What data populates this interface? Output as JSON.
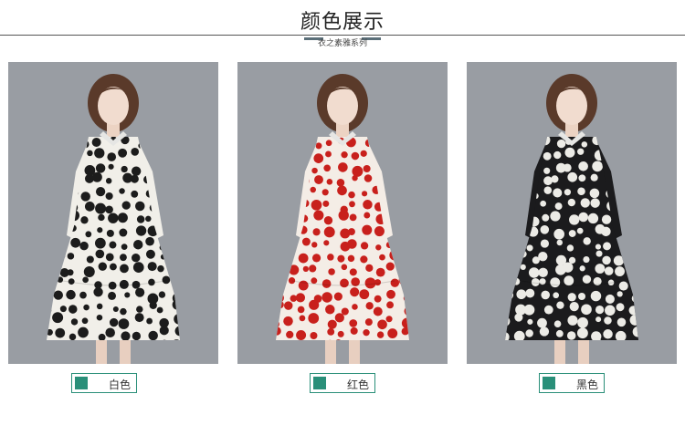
{
  "section": {
    "title": "颜色展示",
    "subtitle": "衣之素雅系列"
  },
  "products": [
    {
      "color_name": "白色",
      "dress_base": "#f1efe9",
      "dot_color": "#1c1c1c",
      "swatch": "#2a8f79"
    },
    {
      "color_name": "红色",
      "dress_base": "#f4ede6",
      "dot_color": "#c8201c",
      "swatch": "#2a8f79"
    },
    {
      "color_name": "黑色",
      "dress_base": "#1b1b1d",
      "dot_color": "#ecebe6",
      "swatch": "#2a8f79"
    }
  ],
  "colors": {
    "photo_background": "#999da3",
    "accent": "#2a8f79",
    "rule": "#555555"
  }
}
